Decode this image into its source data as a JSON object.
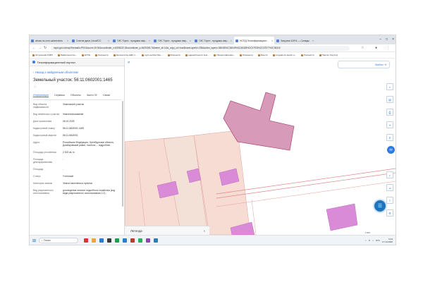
{
  "browser": {
    "tabs": [
      {
        "label": "almaz.vs.com.ua/services",
        "active": false
      },
      {
        "label": "Снятие дачи | local/CC",
        "active": false
      },
      {
        "label": "ГИС Торги - продажа иму...",
        "active": false
      },
      {
        "label": "ГИС Торги - продажа иму...",
        "active": false
      },
      {
        "label": "ГИС Торги - продажа иму...",
        "active": false
      },
      {
        "label": "НСПД Геоинформацион...",
        "active": true
      },
      {
        "label": "Загрузки 100% — Склады",
        "active": false
      }
    ],
    "url": "nspd.gov.ru/map?thematic=PKK&zoom=19.94&coordinate_x=6398132.5&coordinate_y=6425345.7&theme_id=1&is_copy_url=true&baseLayerId=235&active_layers=36048%2C36049%2C36328%2C37578%2C37577%2C36315",
    "bookmarks": [
      "Актуальная СЗРЗ",
      "Правительство...",
      "ЕГРН",
      "Росреестр",
      "Калькулятор НДС о...",
      "курс на Мос.бир...",
      "Росреестр",
      "единый реестр зем...",
      "Предоставление...",
      "Росреестр",
      "Реестр",
      "государств.земли и...",
      "Росреестр",
      "Портал Госуслуг"
    ]
  },
  "panel": {
    "header": "Геоинформационный портал",
    "back_link": "Назад к найденным объектам",
    "title": "Земельный участок: 56:11:0602001:1465",
    "tabs": [
      "Информация",
      "Сервисы",
      "Объекты",
      "Части ЗУ",
      "Связи"
    ],
    "active_tab": "Информация",
    "rows": [
      {
        "key": "Вид объекта недвижимости",
        "value": "Земельный участок"
      },
      {
        "key": "Вид земельного участка",
        "value": "Землепользование"
      },
      {
        "key": "Дата присвоения",
        "value": "08.10.2025"
      },
      {
        "key": "Кадастровый номер",
        "value": "56:11:0602001:1465"
      },
      {
        "key": "Кадастровый квартал",
        "value": "56:11:0602001"
      },
      {
        "key": "Адрес",
        "value": "Российская Федерация, Оренбургская область, Домбаровский район, поселок ... подробнее"
      },
      {
        "key": "Площадь уточненная",
        "value": "2 522 кв. м"
      },
      {
        "key": "Площадь декларированная",
        "value": "-"
      },
      {
        "key": "Площадь",
        "value": "-"
      },
      {
        "key": "Статус",
        "value": "Учтенный"
      },
      {
        "key": "Категория земель",
        "value": "Земли населенных пунктов"
      },
      {
        "key": "Вид разрешенного использования",
        "value": "для ведения личного подсобного хозяйства (код вида разрешенного использования 2.2)"
      }
    ]
  },
  "map": {
    "login": "Войти",
    "legend": "Легенда",
    "scale": "1:000"
  },
  "taskbar": {
    "search": "Поиск",
    "lang": "РУС",
    "time": "9:43",
    "date": "17.10.2025"
  },
  "colors": {
    "accent": "#2c7be5",
    "parcel_selected": "#d79ab8",
    "building": "#d98bd8",
    "parcel_bg": "#f6dcd3"
  }
}
